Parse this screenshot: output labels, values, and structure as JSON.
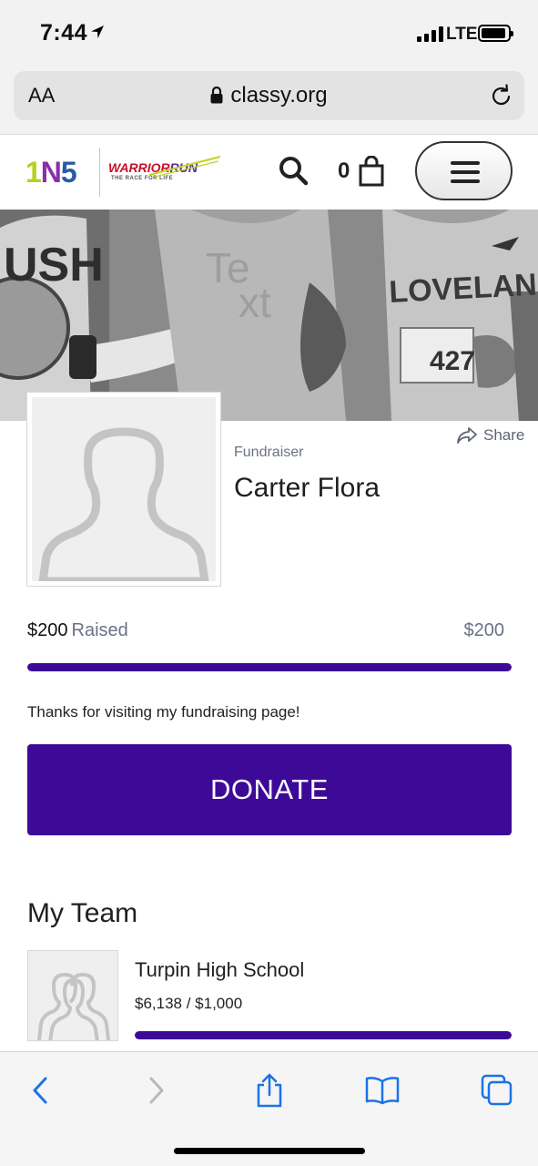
{
  "status_bar": {
    "time": "7:44",
    "network": "LTE"
  },
  "browser": {
    "text_size_label": "AA",
    "url": "classy.org"
  },
  "header": {
    "logo_1n5": {
      "one": "1",
      "n": "N",
      "five": "5"
    },
    "logo_warrior": "WARRIOR",
    "logo_run": "RUN",
    "logo_tagline": "THE RACE FOR LIFE",
    "cart_count": "0"
  },
  "hero": {
    "watermark_line1": "Te",
    "watermark_line2": "xt",
    "jersey_left": "USH",
    "jersey_right": "LOVELAND",
    "bib_number": "427"
  },
  "profile": {
    "share_label": "Share",
    "role": "Fundraiser",
    "name": "Carter Flora"
  },
  "fundraising": {
    "raised_amount": "$200",
    "raised_label": "Raised",
    "goal": "$200",
    "progress_fraction": 1.0,
    "message": "Thanks for visiting my fundraising page!",
    "donate_label": "DONATE"
  },
  "team": {
    "heading": "My Team",
    "name": "Turpin High School",
    "amount": "$6,138 / $1,000",
    "progress_fraction": 1.0
  },
  "colors": {
    "accent": "#3d0a98",
    "ios_blue": "#1a73e8"
  },
  "icons": [
    "location-arrow-icon",
    "lock-icon",
    "reload-icon",
    "search-icon",
    "shopping-bag-icon",
    "hamburger-menu-icon",
    "share-icon",
    "person-silhouette-icon",
    "group-silhouette-icon",
    "back-icon",
    "forward-icon",
    "share-sheet-icon",
    "bookmarks-icon",
    "tabs-icon"
  ]
}
